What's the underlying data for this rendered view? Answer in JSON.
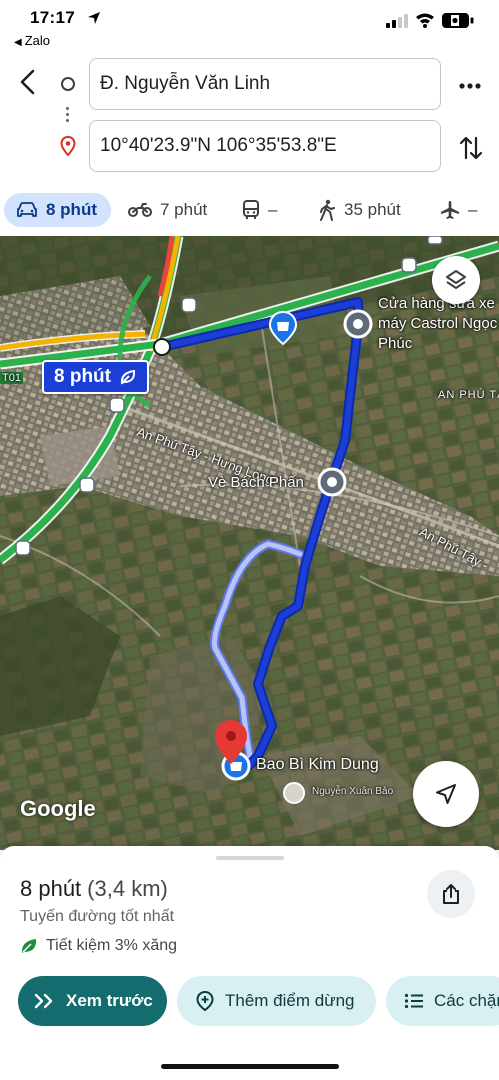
{
  "status_bar": {
    "time": "17:17",
    "back_app": "Zalo"
  },
  "route": {
    "origin": "Đ. Nguyễn Văn Linh",
    "destination": "10°40'23.9\"N 106°35'53.8\"E"
  },
  "modes": [
    {
      "name": "drive",
      "icon": "car-icon",
      "label": "8 phút",
      "active": true
    },
    {
      "name": "motorbike",
      "icon": "motorbike-icon",
      "label": "7 phút",
      "active": false
    },
    {
      "name": "transit",
      "icon": "bus-icon",
      "label": "–",
      "active": false
    },
    {
      "name": "walk",
      "icon": "walk-icon",
      "label": "35 phút",
      "active": false
    },
    {
      "name": "flight",
      "icon": "plane-icon",
      "label": "–",
      "active": false
    }
  ],
  "map": {
    "time_badge": "8 phút",
    "google_logo": "Google",
    "labels": {
      "shop": "Cửa hàng sửa xe máy Castrol Ngọc Phúc",
      "area_an_phu": "AN PHÚ TÂ",
      "street_1": "An Phú Tây - Hưng Long",
      "ve_bach_phan": "Vè Bách Phấn",
      "street_2": "An Phú Tây -",
      "bao_bi": "Bao Bì Kim Dung",
      "user": "Nguyễn Xuân Bảo",
      "highway_tag": "T01"
    }
  },
  "summary": {
    "time": "8 phút",
    "distance": "(3,4 km)",
    "description": "Tuyến đường tốt nhất",
    "eco": "Tiết kiệm 3% xăng"
  },
  "actions": {
    "preview": "Xem trước",
    "add_stop": "Thêm điểm dừng",
    "steps": "Các chặng"
  },
  "colors": {
    "route_blue": "#1a3ed6",
    "alt_route": "#a9b8f5",
    "highway_green": "#2bb24c",
    "primary_button": "#146c6f",
    "chip_active": "#d3e3fd",
    "destination_red": "#e53935"
  }
}
